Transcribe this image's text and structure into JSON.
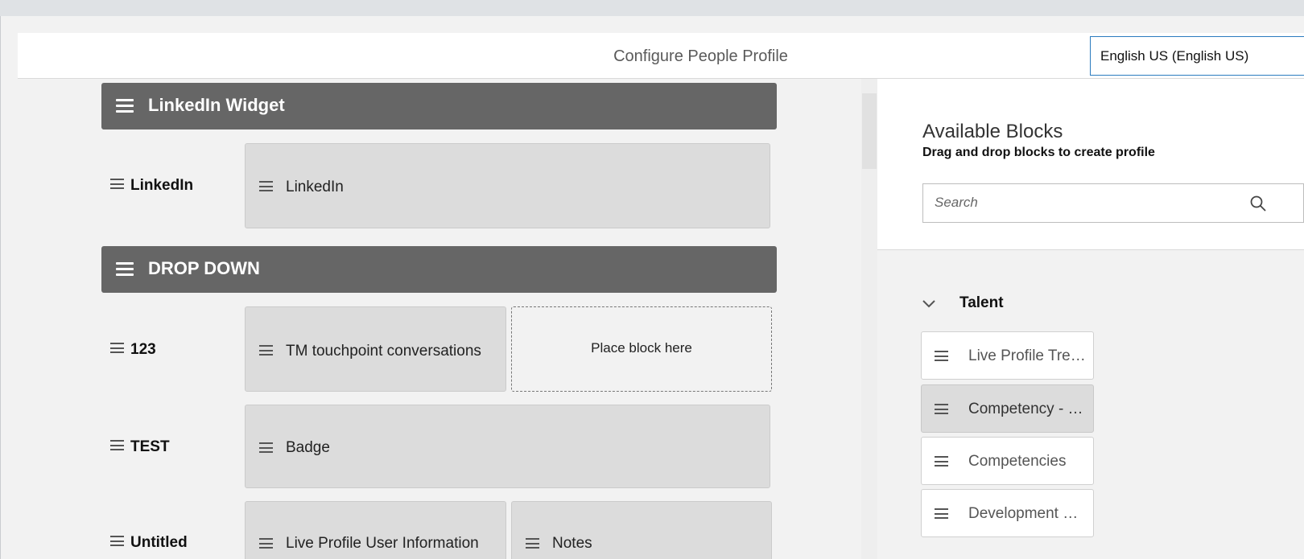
{
  "header": {
    "title": "Configure People Profile",
    "language": "English US (English US)"
  },
  "canvas": {
    "sections": [
      {
        "title": "LinkedIn Widget"
      },
      {
        "title": "DROP DOWN"
      }
    ],
    "rows": [
      {
        "label": "LinkedIn",
        "blocks": [
          "LinkedIn"
        ]
      },
      {
        "label": "123",
        "blocks": [
          "TM touchpoint conversations"
        ],
        "placeholder": "Place block here"
      },
      {
        "label": "TEST",
        "blocks": [
          "Badge"
        ]
      },
      {
        "label": "Untitled",
        "blocks": [
          "Live Profile User Information",
          "Notes"
        ]
      }
    ]
  },
  "panel": {
    "title": "Available Blocks",
    "subtitle": "Drag and drop blocks to create profile",
    "search_placeholder": "Search",
    "category": "Talent",
    "blocks": [
      {
        "label": "Live Profile Trends"
      },
      {
        "label": "Competency - Ratings",
        "selected": true
      },
      {
        "label": "Competencies"
      },
      {
        "label": "Development Goals"
      }
    ]
  },
  "icons": {
    "drag_handle": "hamburger-icon",
    "search": "search-icon",
    "collapse": "chevron-down-icon"
  },
  "colors": {
    "section_bar": "#666666",
    "block": "#dcdcdc",
    "accent_border": "#2a7bbf"
  }
}
